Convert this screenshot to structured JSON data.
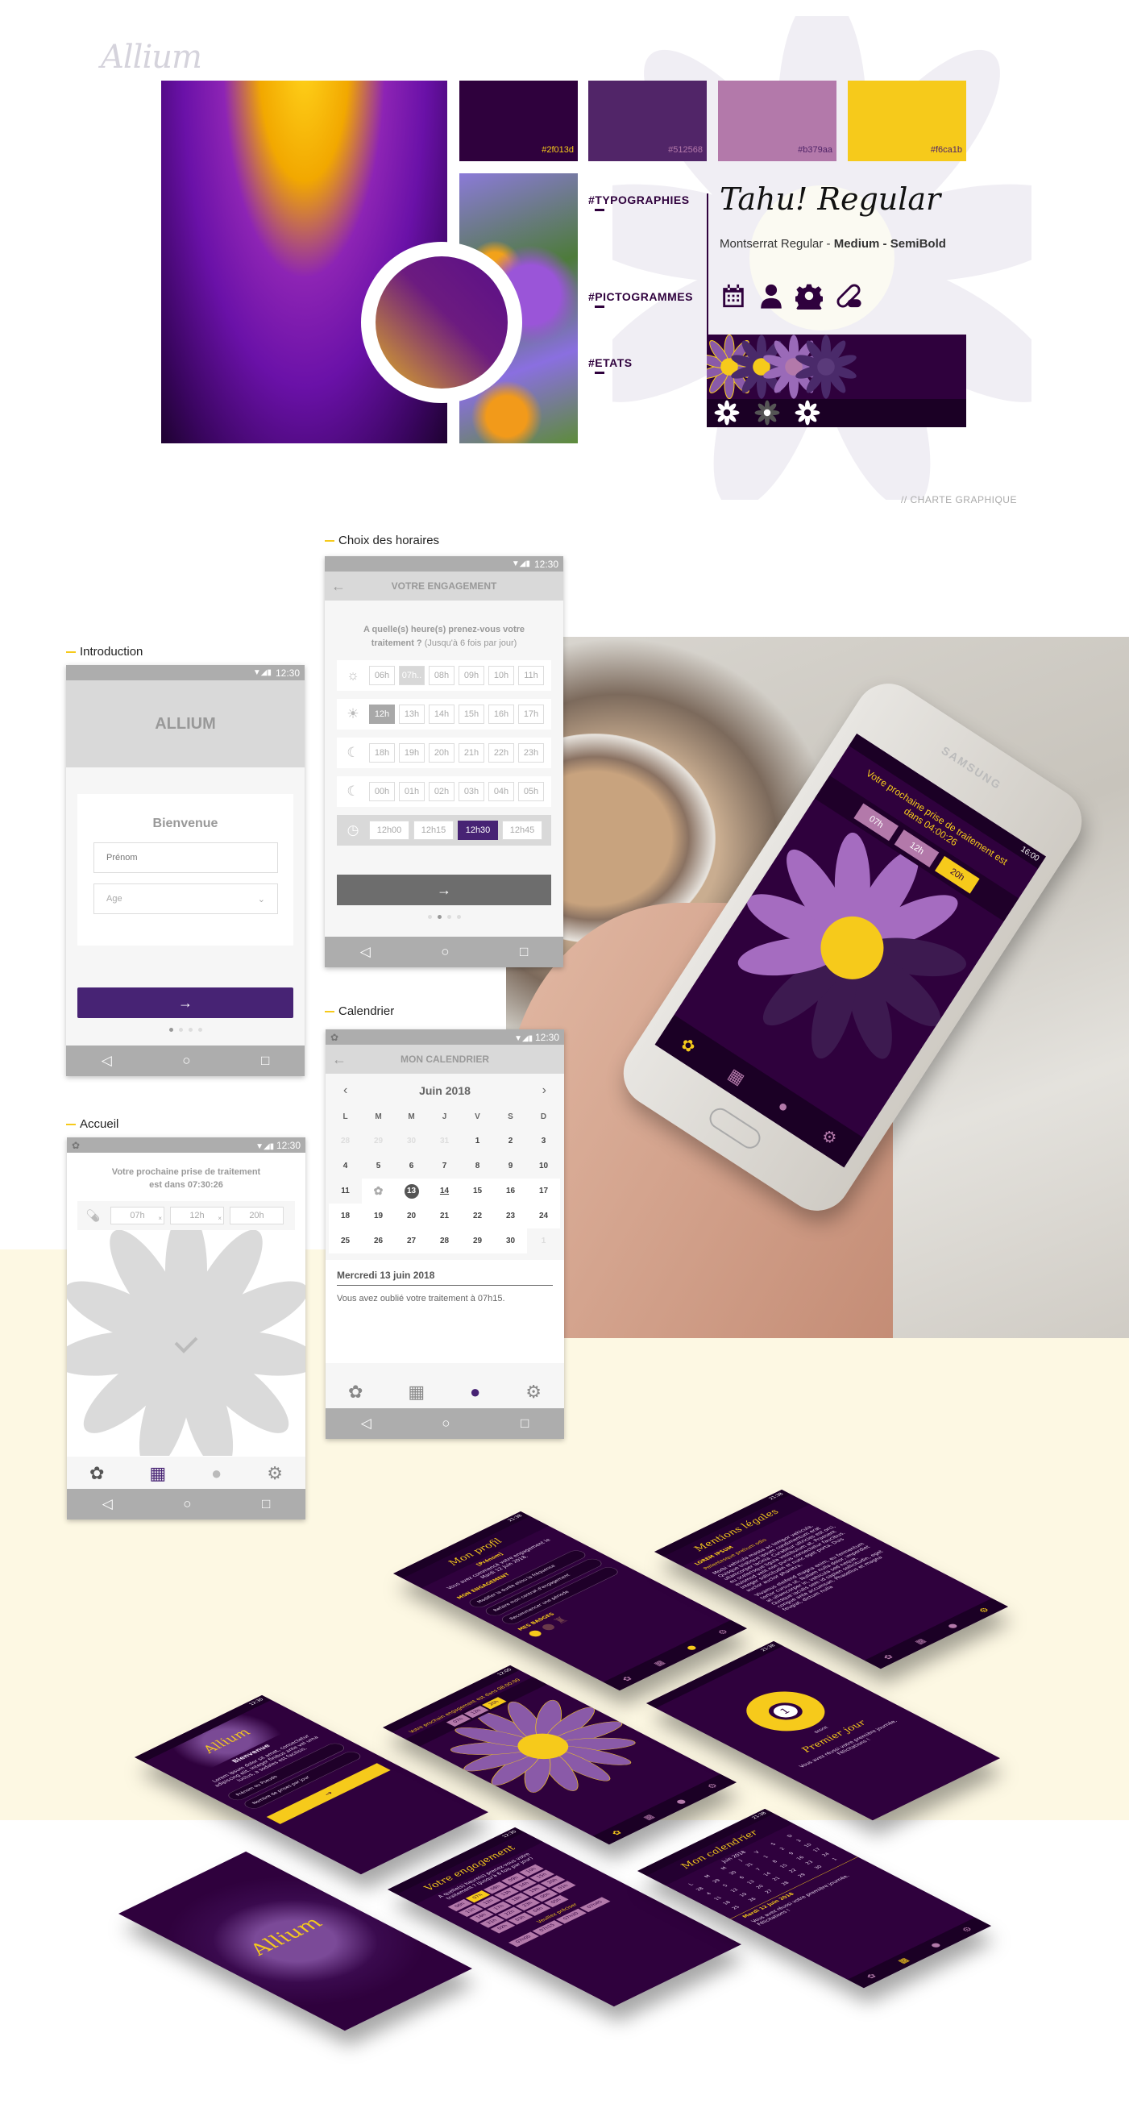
{
  "brand": {
    "logo": "Allium"
  },
  "charte": {
    "swatches": [
      {
        "hex": "#2f013d",
        "label": "#2f013d",
        "text_color": "#f6ca1b"
      },
      {
        "hex": "#512568",
        "label": "#512568",
        "text_color": "#b379aa"
      },
      {
        "hex": "#b379aa",
        "label": "#b379aa",
        "text_color": "#512568"
      },
      {
        "hex": "#f6ca1b",
        "label": "#f6ca1b",
        "text_color": "#512568"
      }
    ],
    "sections": {
      "typographies": "#TYPOGRAPHIES",
      "pictogrammes": "#PICTOGRAMMES",
      "etats": "#ETATS"
    },
    "typo_title": "Tahu! Regular",
    "typo_regular": "Montserrat Regular - ",
    "typo_medium": "Medium - ",
    "typo_semibold": "SemiBold",
    "pictos": [
      "calendar-icon",
      "user-icon",
      "gear-icon",
      "pill-icon"
    ],
    "footer": "// CHARTE GRAPHIQUE"
  },
  "status": {
    "time": "12:30"
  },
  "introduction": {
    "label": "Introduction",
    "app_name": "ALLIUM",
    "welcome": "Bienvenue",
    "prenom_placeholder": "Prénom",
    "age_placeholder": "Age",
    "next_icon": "→",
    "page_index": 0
  },
  "horaires": {
    "label": "Choix des horaires",
    "header": "VOTRE ENGAGEMENT",
    "question_bold": "A quelle(s) heure(s) prenez-vous votre traitement ?",
    "question_note": " (Jusqu'à 6 fois par jour)",
    "rows": [
      {
        "icon": "sunrise-icon",
        "hours": [
          "06h",
          "07h..",
          "08h",
          "09h",
          "10h",
          "11h"
        ],
        "state": [
          "",
          "light",
          "",
          "",
          "",
          ""
        ]
      },
      {
        "icon": "sun-icon",
        "hours": [
          "12h",
          "13h",
          "14h",
          "15h",
          "16h",
          "17h"
        ],
        "state": [
          "sel",
          "",
          "",
          "",
          "",
          ""
        ]
      },
      {
        "icon": "moon-sun-icon",
        "hours": [
          "18h",
          "19h",
          "20h",
          "21h",
          "22h",
          "23h"
        ],
        "state": [
          "",
          "",
          "",
          "",
          "",
          ""
        ]
      },
      {
        "icon": "moon-icon",
        "hours": [
          "00h",
          "01h",
          "02h",
          "03h",
          "04h",
          "05h"
        ],
        "state": [
          "",
          "",
          "",
          "",
          "",
          ""
        ]
      }
    ],
    "minutes": [
      "12h00",
      "12h15",
      "12h30",
      "12h45"
    ],
    "selected_minute": "12h30",
    "next_icon": "→",
    "page_index": 1
  },
  "calendrier": {
    "label": "Calendrier",
    "header": "MON CALENDRIER",
    "month": "Juin 2018",
    "weekdays": [
      "L",
      "M",
      "M",
      "J",
      "V",
      "S",
      "D"
    ],
    "weeks": [
      [
        "28",
        "29",
        "30",
        "31",
        "1",
        "2",
        "3"
      ],
      [
        "4",
        "5",
        "6",
        "7",
        "8",
        "9",
        "10"
      ],
      [
        "11",
        "✿",
        "13",
        "14",
        "15",
        "16",
        "17"
      ],
      [
        "18",
        "19",
        "20",
        "21",
        "22",
        "23",
        "24"
      ],
      [
        "25",
        "26",
        "27",
        "28",
        "29",
        "30",
        "1"
      ]
    ],
    "muted": [
      "0-0",
      "0-1",
      "0-2",
      "0-3",
      "4-6"
    ],
    "selected_day": "13",
    "today": "14",
    "day_title": "Mercredi 13 juin 2018",
    "day_text": "Vous avez oublié votre traitement à 07h15.",
    "active_tab": "profile"
  },
  "accueil": {
    "label": "Accueil",
    "next_line1": "Votre prochaine prise de traitement",
    "next_line2": "est dans 07:30:26",
    "doses": [
      "07h",
      "12h",
      "20h"
    ],
    "doses_taken": [
      true,
      true,
      false
    ],
    "active_tab": "calendar"
  },
  "photo_phone": {
    "brand": "SAMSUNG",
    "time": "16:00",
    "next": "Votre prochaine prise de traitement est dans 04:00:26",
    "doses": [
      "07h",
      "12h",
      "20h"
    ]
  },
  "iso_screens": {
    "profil": {
      "time": "21:38",
      "title": "Mon profil",
      "name": "[Prénom]",
      "since": "Vous avez commencé votre engagement le Mardi 12 Juin 2018.",
      "section": "MON ENGAGEMENT",
      "actions": [
        "Modifier la durée et/ou la fréquence",
        "Refaire mon contrat d'engagement",
        "Recommencer une période"
      ],
      "badges": "MES BADGES"
    },
    "mentions": {
      "time": "21:38",
      "title": "Mentions légales",
      "h1": "LOREM IPSUM",
      "h2": "Pellentesque pretium odio",
      "p1": "Morbi vehicula massa ac tempor vehicula. Quisque tristique ipsum condimentum erat ullamcorper lacinia. Curabitur ultricies est orci, eu scelerisque ligula vestibulum at. Praesent euismod velit non purus consectetur faucibus. Integer sollicitudin et nunc eget porta. Duis auctor auctor pharetra.",
      "p2": "Vivamus eleifend magna enim, eu fermentum tortor cursus ut. Nullam nulla dolor, imperdiet at ullamcorper in, vehicula sed neque. Quisque iaculis sem id sapien sollicitudin, eget congue ante accumsan. Phasellus et magna feugiat, dictum nulla"
    },
    "bienvenue": {
      "time": "12:30",
      "logo": "Allium",
      "title": "Bienvenue",
      "text": "Lorem ipsum dolor sit amet, consectetur adipiscing elit. Integer finibus ante vel urna luctus, a sodales est facilisis.",
      "field1": "Prénom ou Pseudo",
      "field2": "Nombre de prises par jour",
      "next": "→"
    },
    "home": {
      "time": "12:00",
      "text": "Votre prochain engagement est dans 08:00:00",
      "doses": [
        "07h",
        "12h",
        "20h"
      ]
    },
    "premier": {
      "time": "21:38",
      "badge_label": "BADGE",
      "title": "Premier jour",
      "text": "Vous avez réussi votre première journée. Félicitations !",
      "badge_number": "1"
    },
    "splash": {
      "logo": "Allium"
    },
    "engagement": {
      "time": "12:30",
      "title": "Votre engagement",
      "question": "A quelle(s) heure(s) prenez-vous votre traitement ? (Jusqu'à 6 fois par jour)",
      "hours": [
        "06h",
        "07h",
        "08h",
        "09h",
        "10h",
        "11h",
        "12h",
        "13h",
        "14h",
        "15h",
        "16h",
        "17h",
        "18h",
        "19h",
        "20h",
        "21h",
        "22h",
        "23h",
        "00h",
        "01h",
        "02h",
        "03h",
        "04h",
        "05h"
      ],
      "selected": "07h",
      "precise": "Veuillez préciser",
      "minutes": [
        "07h00",
        "07h15",
        "07h30",
        "07h45"
      ]
    },
    "calendrier": {
      "time": "21:38",
      "title": "Mon calendrier",
      "month": "Juin 2018",
      "weekdays": [
        "L",
        "M",
        "M",
        "J",
        "V",
        "S",
        "D"
      ],
      "days": [
        "28",
        "29",
        "30",
        "31",
        "1",
        "2",
        "3",
        "4",
        "5",
        "6",
        "7",
        "8",
        "9",
        "10",
        "11",
        "12",
        "13",
        "14",
        "15",
        "16",
        "17",
        "18",
        "19",
        "20",
        "21",
        "22",
        "23",
        "24",
        "25",
        "26",
        "27",
        "28",
        "29",
        "30",
        "1"
      ],
      "day_title": "Mardi 12 Juin 2018",
      "day_text": "Vous avez réussi votre première journée. Félicitations !"
    }
  }
}
